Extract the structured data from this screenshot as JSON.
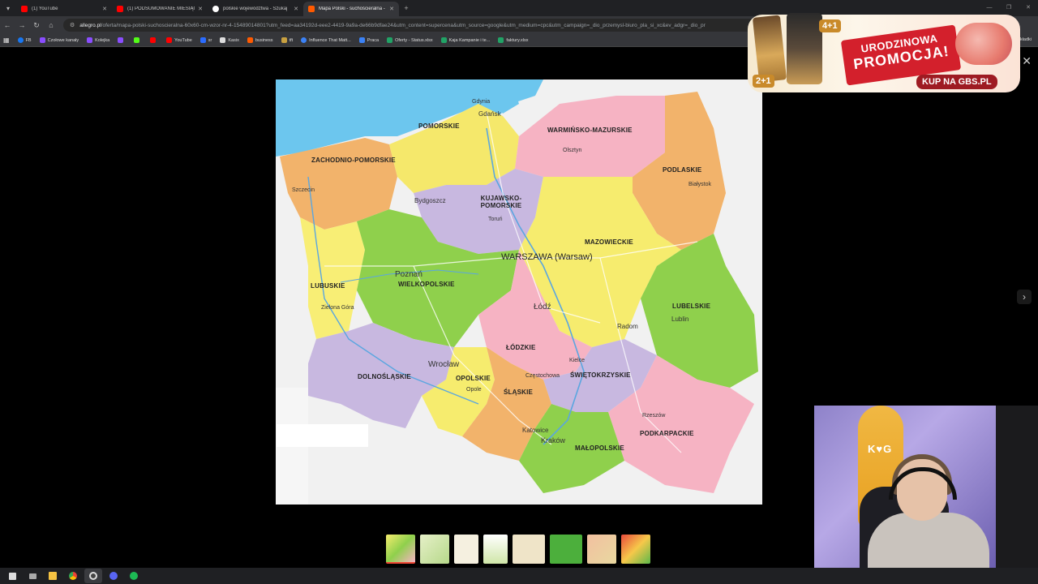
{
  "browser": {
    "tabs": [
      {
        "title": "(1) YouTube",
        "favicon_color": "#ff0000",
        "active": false
      },
      {
        "title": "(1) PODSUMOWANIE MIESIĄC",
        "favicon_color": "#ff0000",
        "active": false
      },
      {
        "title": "polskie województwa - Szukaj",
        "favicon_color": "#ffffff",
        "active": false
      },
      {
        "title": "Mapa Polski - suchościeralna -",
        "favicon_color": "#ff5a00",
        "active": true
      }
    ],
    "new_tab": "+",
    "url_host": "allegro.pl",
    "url_path": "/oferta/mapa-polski-suchoscieralna-60x60-cm-wzor-nr-4-15489014801?utm_feed=aa34192d-eee2-4419-9a9a-de66b9dfae24&utm_content=supercena&utm_source=google&utm_medium=cpc&utm_campaign=_dio_przemysl-biuro_pla_si_xc&ev_adgr=_dio_pr",
    "bookmarks": [
      {
        "label": "FB",
        "color": "#1877f2"
      },
      {
        "label": "Czołowe kanały",
        "color": "#8a4dff"
      },
      {
        "label": "Kolejka",
        "color": "#8a4dff"
      },
      {
        "label": "",
        "color": "#8a4dff"
      },
      {
        "label": "",
        "color": "#53fc18"
      },
      {
        "label": "",
        "color": "#ff0000"
      },
      {
        "label": "YouTube",
        "color": "#ff0000"
      },
      {
        "label": "sr",
        "color": "#2b6cff"
      },
      {
        "label": "Kasix",
        "color": "#ffffff"
      },
      {
        "label": "business",
        "color": "#ff5a00"
      },
      {
        "label": "tft",
        "color": "#c8a040"
      },
      {
        "label": "Influence That Matt...",
        "color": "#3b82f6"
      },
      {
        "label": "Praca",
        "color": "#3b82f6"
      },
      {
        "label": "Oferty - Status.xlsx",
        "color": "#21a366"
      },
      {
        "label": "Kaja Kampanie i te...",
        "color": "#21a366"
      },
      {
        "label": "faktury.xlsx",
        "color": "#21a366"
      }
    ],
    "bookmarks_overflow": "Wszystkie zakładki"
  },
  "map": {
    "regions": [
      {
        "name": "POMORSKIE"
      },
      {
        "name": "WARMIŃSKO-MAZURSKIE"
      },
      {
        "name": "ZACHODNIO-POMORSKIE"
      },
      {
        "name": "PODLASKIE"
      },
      {
        "name": "KUJAWSKO-POMORSKIE"
      },
      {
        "name": "MAZOWIECKIE"
      },
      {
        "name": "LUBUSKIE"
      },
      {
        "name": "WIELKOPOLSKIE"
      },
      {
        "name": "LUBELSKIE"
      },
      {
        "name": "ŁÓDZKIE"
      },
      {
        "name": "DOLNOŚLĄSKIE"
      },
      {
        "name": "OPOLSKIE"
      },
      {
        "name": "ŚWIĘTOKRZYSKIE"
      },
      {
        "name": "ŚLĄSKIE"
      },
      {
        "name": "PODKARPACKIE"
      },
      {
        "name": "MAŁOPOLSKIE"
      }
    ],
    "capital": "WARSZAWA (Warsaw)",
    "cities": [
      {
        "name": "Gdańsk"
      },
      {
        "name": "Gdynia"
      },
      {
        "name": "Bydgoszcz"
      },
      {
        "name": "Toruń"
      },
      {
        "name": "Poznań"
      },
      {
        "name": "Łódź"
      },
      {
        "name": "Białystok"
      },
      {
        "name": "Lublin"
      },
      {
        "name": "Radom"
      },
      {
        "name": "Wrocław"
      },
      {
        "name": "Kielce"
      },
      {
        "name": "Częstochowa"
      },
      {
        "name": "Katowice"
      },
      {
        "name": "Kraków"
      },
      {
        "name": "Rzeszów"
      },
      {
        "name": "Opole"
      },
      {
        "name": "Zielona Góra"
      },
      {
        "name": "Olsztyn"
      },
      {
        "name": "Szczecin"
      }
    ]
  },
  "ad": {
    "headline_line1": "URODZINOWA",
    "headline_line2": "PROMOCJA!",
    "cta": "KUP NA GBS.PL",
    "badge_a": "4+1",
    "badge_b": "2+1"
  },
  "webcam": {
    "logo": "K♥G"
  },
  "icons": {
    "close": "✕",
    "next": "›",
    "back": "←",
    "forward": "→",
    "reload": "↻",
    "home": "⌂"
  }
}
